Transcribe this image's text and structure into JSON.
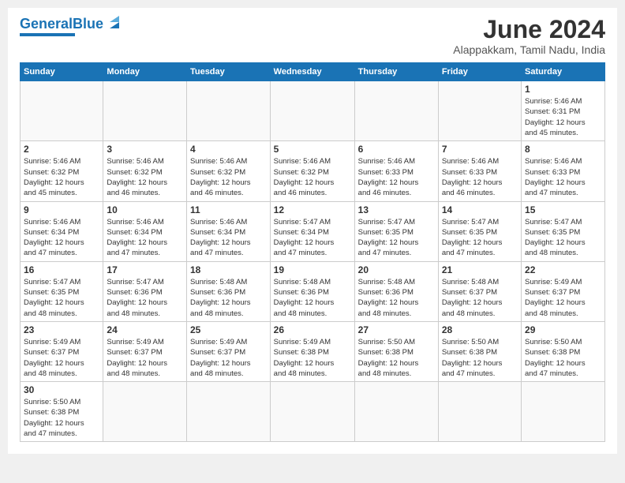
{
  "logo": {
    "text1": "General",
    "text2": "Blue"
  },
  "title": "June 2024",
  "subtitle": "Alappakkam, Tamil Nadu, India",
  "days_of_week": [
    "Sunday",
    "Monday",
    "Tuesday",
    "Wednesday",
    "Thursday",
    "Friday",
    "Saturday"
  ],
  "weeks": [
    [
      {
        "day": "",
        "info": ""
      },
      {
        "day": "",
        "info": ""
      },
      {
        "day": "",
        "info": ""
      },
      {
        "day": "",
        "info": ""
      },
      {
        "day": "",
        "info": ""
      },
      {
        "day": "",
        "info": ""
      },
      {
        "day": "1",
        "info": "Sunrise: 5:46 AM\nSunset: 6:31 PM\nDaylight: 12 hours\nand 45 minutes."
      }
    ],
    [
      {
        "day": "2",
        "info": "Sunrise: 5:46 AM\nSunset: 6:32 PM\nDaylight: 12 hours\nand 45 minutes."
      },
      {
        "day": "3",
        "info": "Sunrise: 5:46 AM\nSunset: 6:32 PM\nDaylight: 12 hours\nand 46 minutes."
      },
      {
        "day": "4",
        "info": "Sunrise: 5:46 AM\nSunset: 6:32 PM\nDaylight: 12 hours\nand 46 minutes."
      },
      {
        "day": "5",
        "info": "Sunrise: 5:46 AM\nSunset: 6:32 PM\nDaylight: 12 hours\nand 46 minutes."
      },
      {
        "day": "6",
        "info": "Sunrise: 5:46 AM\nSunset: 6:33 PM\nDaylight: 12 hours\nand 46 minutes."
      },
      {
        "day": "7",
        "info": "Sunrise: 5:46 AM\nSunset: 6:33 PM\nDaylight: 12 hours\nand 46 minutes."
      },
      {
        "day": "8",
        "info": "Sunrise: 5:46 AM\nSunset: 6:33 PM\nDaylight: 12 hours\nand 47 minutes."
      }
    ],
    [
      {
        "day": "9",
        "info": "Sunrise: 5:46 AM\nSunset: 6:34 PM\nDaylight: 12 hours\nand 47 minutes."
      },
      {
        "day": "10",
        "info": "Sunrise: 5:46 AM\nSunset: 6:34 PM\nDaylight: 12 hours\nand 47 minutes."
      },
      {
        "day": "11",
        "info": "Sunrise: 5:46 AM\nSunset: 6:34 PM\nDaylight: 12 hours\nand 47 minutes."
      },
      {
        "day": "12",
        "info": "Sunrise: 5:47 AM\nSunset: 6:34 PM\nDaylight: 12 hours\nand 47 minutes."
      },
      {
        "day": "13",
        "info": "Sunrise: 5:47 AM\nSunset: 6:35 PM\nDaylight: 12 hours\nand 47 minutes."
      },
      {
        "day": "14",
        "info": "Sunrise: 5:47 AM\nSunset: 6:35 PM\nDaylight: 12 hours\nand 47 minutes."
      },
      {
        "day": "15",
        "info": "Sunrise: 5:47 AM\nSunset: 6:35 PM\nDaylight: 12 hours\nand 48 minutes."
      }
    ],
    [
      {
        "day": "16",
        "info": "Sunrise: 5:47 AM\nSunset: 6:35 PM\nDaylight: 12 hours\nand 48 minutes."
      },
      {
        "day": "17",
        "info": "Sunrise: 5:47 AM\nSunset: 6:36 PM\nDaylight: 12 hours\nand 48 minutes."
      },
      {
        "day": "18",
        "info": "Sunrise: 5:48 AM\nSunset: 6:36 PM\nDaylight: 12 hours\nand 48 minutes."
      },
      {
        "day": "19",
        "info": "Sunrise: 5:48 AM\nSunset: 6:36 PM\nDaylight: 12 hours\nand 48 minutes."
      },
      {
        "day": "20",
        "info": "Sunrise: 5:48 AM\nSunset: 6:36 PM\nDaylight: 12 hours\nand 48 minutes."
      },
      {
        "day": "21",
        "info": "Sunrise: 5:48 AM\nSunset: 6:37 PM\nDaylight: 12 hours\nand 48 minutes."
      },
      {
        "day": "22",
        "info": "Sunrise: 5:49 AM\nSunset: 6:37 PM\nDaylight: 12 hours\nand 48 minutes."
      }
    ],
    [
      {
        "day": "23",
        "info": "Sunrise: 5:49 AM\nSunset: 6:37 PM\nDaylight: 12 hours\nand 48 minutes."
      },
      {
        "day": "24",
        "info": "Sunrise: 5:49 AM\nSunset: 6:37 PM\nDaylight: 12 hours\nand 48 minutes."
      },
      {
        "day": "25",
        "info": "Sunrise: 5:49 AM\nSunset: 6:37 PM\nDaylight: 12 hours\nand 48 minutes."
      },
      {
        "day": "26",
        "info": "Sunrise: 5:49 AM\nSunset: 6:38 PM\nDaylight: 12 hours\nand 48 minutes."
      },
      {
        "day": "27",
        "info": "Sunrise: 5:50 AM\nSunset: 6:38 PM\nDaylight: 12 hours\nand 48 minutes."
      },
      {
        "day": "28",
        "info": "Sunrise: 5:50 AM\nSunset: 6:38 PM\nDaylight: 12 hours\nand 47 minutes."
      },
      {
        "day": "29",
        "info": "Sunrise: 5:50 AM\nSunset: 6:38 PM\nDaylight: 12 hours\nand 47 minutes."
      }
    ],
    [
      {
        "day": "30",
        "info": "Sunrise: 5:50 AM\nSunset: 6:38 PM\nDaylight: 12 hours\nand 47 minutes."
      },
      {
        "day": "",
        "info": ""
      },
      {
        "day": "",
        "info": ""
      },
      {
        "day": "",
        "info": ""
      },
      {
        "day": "",
        "info": ""
      },
      {
        "day": "",
        "info": ""
      },
      {
        "day": "",
        "info": ""
      }
    ]
  ]
}
